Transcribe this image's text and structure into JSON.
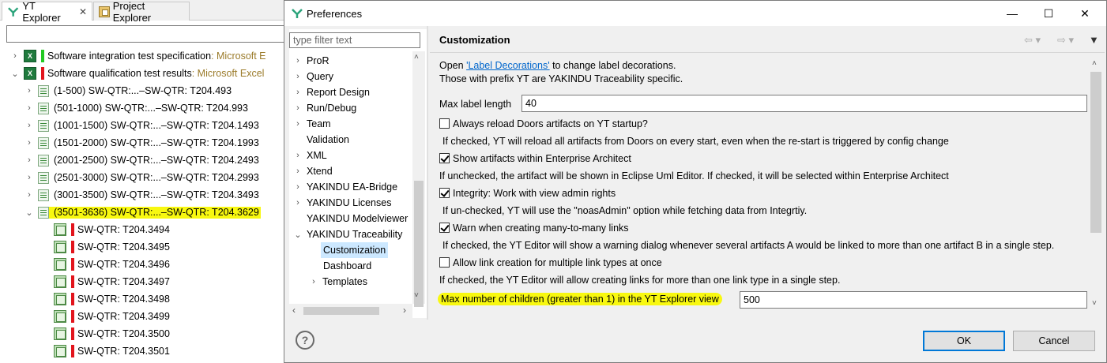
{
  "explorer": {
    "tabs": [
      {
        "label": "YT Explorer",
        "close": "✕"
      },
      {
        "label": "Project Explorer"
      }
    ],
    "filter_value": "",
    "tree": [
      {
        "label": "Software integration test specification",
        "type": " : Microsoft E"
      },
      {
        "label": "Software qualification test results",
        "type": " : Microsoft Excel"
      }
    ],
    "groups": [
      "(1-500) SW-QTR:...–SW-QTR: T204.493",
      "(501-1000) SW-QTR:...–SW-QTR: T204.993",
      "(1001-1500) SW-QTR:...–SW-QTR: T204.1493",
      "(1501-2000) SW-QTR:...–SW-QTR: T204.1993",
      "(2001-2500) SW-QTR:...–SW-QTR: T204.2493",
      "(2501-3000) SW-QTR:...–SW-QTR: T204.2993",
      "(3001-3500) SW-QTR:...–SW-QTR: T204.3493",
      "(3501-3636) SW-QTR:...–SW-QTR: T204.3629"
    ],
    "artifacts": [
      "SW-QTR: T204.3494",
      "SW-QTR: T204.3495",
      "SW-QTR: T204.3496",
      "SW-QTR: T204.3497",
      "SW-QTR: T204.3498",
      "SW-QTR: T204.3499",
      "SW-QTR: T204.3500",
      "SW-QTR: T204.3501"
    ]
  },
  "dialog": {
    "title": "Preferences",
    "window_controls": {
      "minimize": "—",
      "maximize": "☐",
      "close": "✕"
    },
    "nav_filter_placeholder": "type filter text",
    "nav_items": [
      {
        "label": "ProR",
        "expandable": true
      },
      {
        "label": "Query",
        "expandable": true
      },
      {
        "label": "Report Design",
        "expandable": true
      },
      {
        "label": "Run/Debug",
        "expandable": true
      },
      {
        "label": "Team",
        "expandable": true
      },
      {
        "label": "Validation",
        "expandable": false
      },
      {
        "label": "XML",
        "expandable": true
      },
      {
        "label": "Xtend",
        "expandable": true
      },
      {
        "label": "YAKINDU EA-Bridge",
        "expandable": true
      },
      {
        "label": "YAKINDU Licenses",
        "expandable": true
      },
      {
        "label": "YAKINDU Modelviewer",
        "expandable": false
      },
      {
        "label": "YAKINDU Traceability",
        "expandable": true
      }
    ],
    "nav_children": [
      "Customization",
      "Dashboard",
      "Templates"
    ],
    "nav_selected": "Customization",
    "page_title": "Customization",
    "intro_prefix": "Open ",
    "intro_link": "'Label Decorations'",
    "intro_suffix": " to change label decorations.",
    "intro_line2": "Those with prefix YT are YAKINDU Traceability specific.",
    "max_label_length_label": "Max label length",
    "max_label_length_value": "40",
    "options": [
      {
        "label": "Always reload Doors artifacts on YT startup?",
        "checked": false,
        "help": "If checked, YT will reload all artifacts from Doors on every start, even when the re-start is triggered by config change"
      },
      {
        "label": "Show artifacts within Enterprise Architect",
        "checked": true,
        "help": "If unchecked, the artifact will be shown in Eclipse Uml Editor. If checked, it will be selected within Enterprise Architect"
      },
      {
        "label": "Integrity: Work with view admin rights",
        "checked": true,
        "help": "If un-checked, YT will use the \"noasAdmin\" option while fetching data from Integrtiy."
      },
      {
        "label": "Warn when creating many-to-many links",
        "checked": true,
        "help": "If checked, the YT Editor will show a warning dialog whenever several artifacts A would be linked to more than one artifact B in a single step."
      },
      {
        "label": "Allow link creation for multiple link types at once",
        "checked": false,
        "help": "If checked, the YT Editor will allow creating links for more than one link type in a single step."
      }
    ],
    "max_children_label": "Max number of children (greater than 1) in the YT Explorer view",
    "max_children_value": "500",
    "ok_label": "OK",
    "cancel_label": "Cancel",
    "help_glyph": "?"
  },
  "colors": {
    "highlight": "#f8f810",
    "link": "#0066cc",
    "green_marker": "#22c922",
    "red_marker": "#e2141c"
  }
}
